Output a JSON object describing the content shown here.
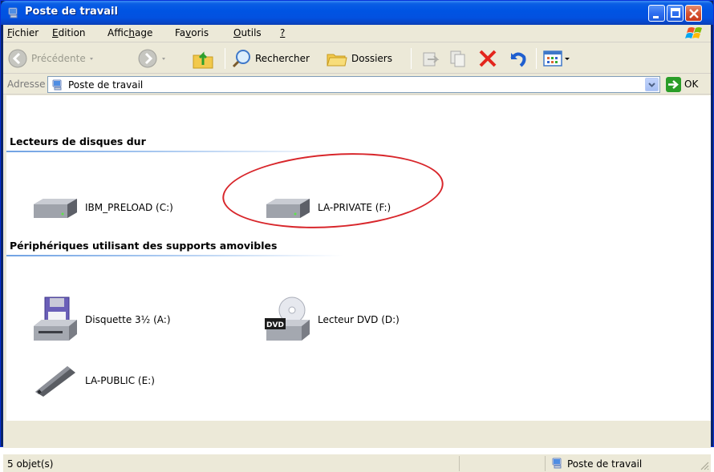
{
  "window": {
    "title": "Poste de travail"
  },
  "menu": {
    "items": [
      {
        "label_pre": "",
        "label_ul": "F",
        "label_post": "ichier"
      },
      {
        "label_pre": "",
        "label_ul": "E",
        "label_post": "dition"
      },
      {
        "label_pre": "Affic",
        "label_ul": "h",
        "label_post": "age"
      },
      {
        "label_pre": "Fa",
        "label_ul": "v",
        "label_post": "oris"
      },
      {
        "label_pre": "",
        "label_ul": "O",
        "label_post": "utils"
      },
      {
        "label_pre": "",
        "label_ul": "?",
        "label_post": ""
      }
    ]
  },
  "toolbar": {
    "back_label": "Précédente",
    "search_label": "Rechercher",
    "folders_label": "Dossiers"
  },
  "address": {
    "label": "Adresse",
    "value": "Poste de travail",
    "go_label": "OK"
  },
  "groups": [
    {
      "header": "Lecteurs de disques dur",
      "items": [
        {
          "label": "IBM_PRELOAD (C:)",
          "icon": "hard-drive-icon"
        },
        {
          "label": "LA-PRIVATE (F:)",
          "icon": "hard-drive-icon"
        }
      ]
    },
    {
      "header": "Périphériques utilisant des supports amovibles",
      "items": [
        {
          "label": "Disquette 3½ (A:)",
          "icon": "floppy-drive-icon"
        },
        {
          "label": "Lecteur DVD (D:)",
          "icon": "dvd-drive-icon"
        },
        {
          "label": "LA-PUBLIC (E:)",
          "icon": "usb-drive-icon"
        }
      ]
    }
  ],
  "status": {
    "count": "5 objet(s)",
    "location": "Poste de travail"
  },
  "colors": {
    "titlebar": "#0054e3",
    "highlight_ellipse": "#d8262b"
  }
}
